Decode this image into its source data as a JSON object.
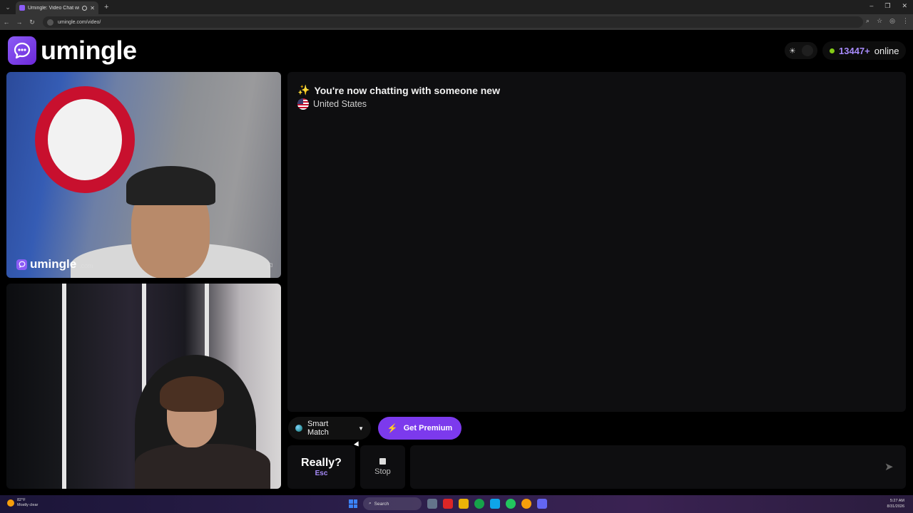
{
  "browser": {
    "tab_title": "Umingle: Video Chat with S",
    "url": "umingle.com/video/"
  },
  "header": {
    "logo_text": "umingle",
    "online_count": "13447+",
    "online_label": "online"
  },
  "video_remote": {
    "watermark_text": "umingle",
    "watermark_domain": ".com"
  },
  "chat": {
    "message": "You're now chatting with someone new",
    "country": "United States"
  },
  "controls": {
    "smart_match_label": "Smart Match",
    "premium_label": "Get Premium",
    "skip_label": "Really?",
    "skip_shortcut": "Esc",
    "stop_label": "Stop",
    "message_placeholder": ""
  },
  "taskbar": {
    "weather_temp": "82°F",
    "weather_desc": "Mostly clear",
    "search_label": "Search",
    "time": "5:27 AM",
    "date": "8/31/2026"
  },
  "colors": {
    "brand": "#8b5cf6",
    "premium": "#7c3aed",
    "online_dot": "#84cc16"
  }
}
